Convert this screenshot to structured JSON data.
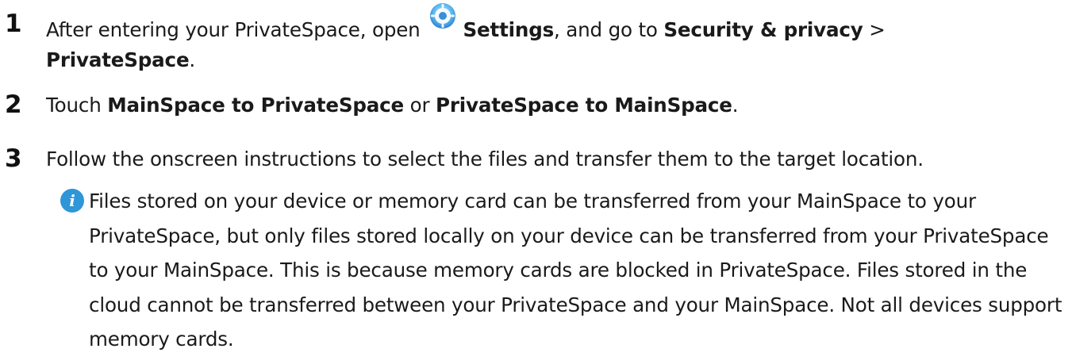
{
  "steps": [
    {
      "number": "1",
      "part_a": "After entering your PrivateSpace, open",
      "settings_label": "Settings",
      "part_b": ", and go to",
      "security_label": "Security & privacy",
      "separator": " >",
      "privatespace_label": "PrivateSpace",
      "end": "."
    },
    {
      "number": "2",
      "part_a": "Touch ",
      "option_a": "MainSpace to PrivateSpace",
      "part_b": " or ",
      "option_b": "PrivateSpace to MainSpace",
      "end": "."
    },
    {
      "number": "3",
      "text": "Follow the onscreen instructions to select the files and transfer them to the target location."
    }
  ],
  "note": {
    "icon": "info-icon",
    "text": "Files stored on your device or memory card can be transferred from your MainSpace to your PrivateSpace, but only files stored locally on your device can be transferred from your PrivateSpace to your MainSpace. This is because memory cards are blocked in PrivateSpace. Files stored in the cloud cannot be transferred between your PrivateSpace and your MainSpace. Not all devices support memory cards."
  },
  "colors": {
    "text": "#1a1a1a",
    "info_icon": "#2f96d8",
    "settings_icon_primary": "#3a8fd9",
    "settings_icon_secondary": "#8fd3f5"
  }
}
